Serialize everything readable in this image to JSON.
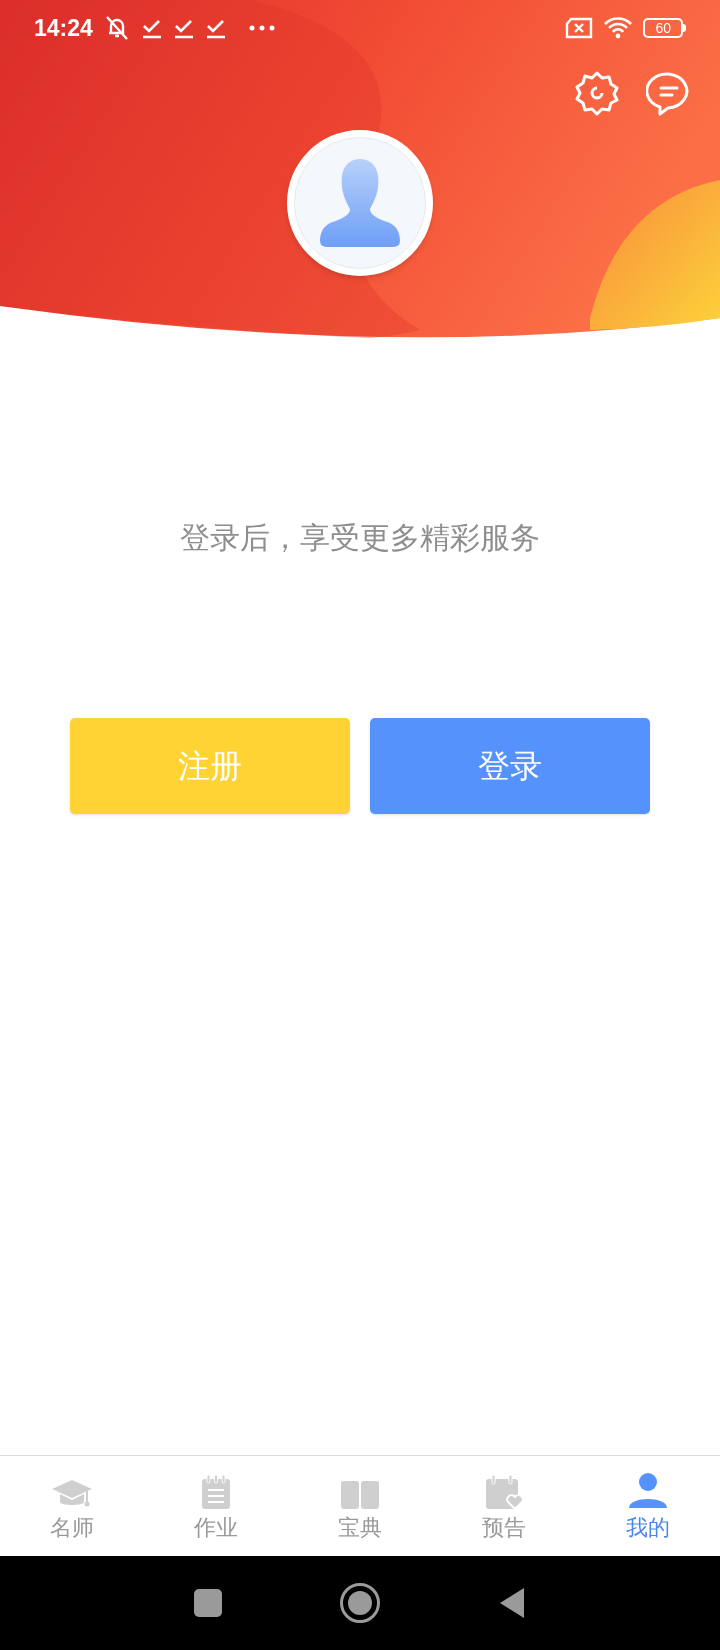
{
  "status_bar": {
    "time": "14:24",
    "battery": "60"
  },
  "prompt": "登录后，享受更多精彩服务",
  "buttons": [
    {
      "kind": "register",
      "label": "注册"
    },
    {
      "kind": "login",
      "label": "登录"
    }
  ],
  "tabs": [
    {
      "kind": "teacher",
      "label": "名师",
      "selected": false
    },
    {
      "kind": "homework",
      "label": "作业",
      "selected": false
    },
    {
      "kind": "book",
      "label": "宝典",
      "selected": false
    },
    {
      "kind": "calendar",
      "label": "预告",
      "selected": false
    },
    {
      "kind": "person",
      "label": "我的",
      "selected": true
    }
  ]
}
